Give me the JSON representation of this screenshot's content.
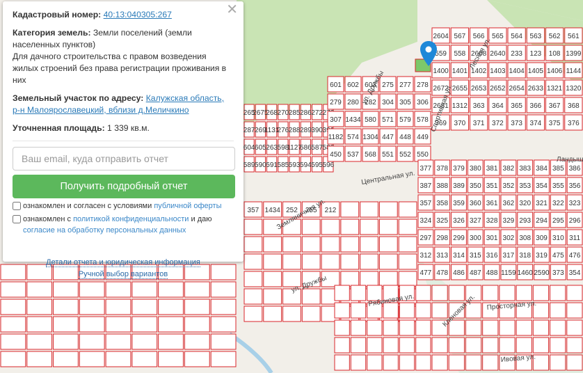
{
  "popup": {
    "cadastral_label": "Кадастровый номер:",
    "cadastral_number": "40:13:040305:267",
    "category_label": "Категория земель:",
    "category_value": "Земли поселений (земли населенных пунктов)",
    "usage": "Для дачного строительства с правом возведения жилых строений без права регистрации проживания в них",
    "address_label": "Земельный участок по адресу:",
    "address_value": "Калужская область, р-н Малоярославецкий, вблизи д.Меличкино",
    "area_label": "Уточненная площадь:",
    "area_value": "1 339 кв.м.",
    "email_placeholder": "Ваш email, куда отправить отчет",
    "submit_label": "Получить подробный отчет",
    "check1_text": "ознакомлен и согласен с условиями ",
    "check1_link": "публичной оферты",
    "check2_text": "ознакомлен с ",
    "check2_link": "политикой конфиденциальности",
    "check2_mid": " и даю ",
    "check2_link2": "согласие на обработку персональных данных",
    "details_link": "Детали отчета и юридическая информация",
    "manual_link": "Ручной выбор вариантов",
    "close": "✕"
  },
  "map": {
    "colors": {
      "parcel": "#d9262a",
      "green": "#c9e4b4",
      "selected": "#7cc86a",
      "pin": "#1e88d8"
    },
    "streets": [
      "ул. Дружбы",
      "Спортивная ул.",
      "Лесная ул.",
      "Центральная ул.",
      "Земляничная ул.",
      "Рябиновая ул.",
      "Кленовая ул.",
      "Просторная ул.",
      "Ивовая ул.",
      "Ландыш",
      "ул. Дружбы"
    ],
    "parcels": [
      "265",
      "2675",
      "268",
      "270",
      "285",
      "286",
      "272",
      "273",
      "287",
      "269",
      "1131",
      "276",
      "288",
      "289",
      "390",
      "391",
      "604",
      "605",
      "263",
      "598",
      "1127",
      "586",
      "587",
      "588",
      "589",
      "590",
      "591",
      "585",
      "593",
      "594",
      "595",
      "596",
      "601",
      "602",
      "603",
      "275",
      "277",
      "278",
      "279",
      "280",
      "282",
      "304",
      "305",
      "306",
      "307",
      "1434",
      "580",
      "571",
      "579",
      "578",
      "1182",
      "574",
      "1304",
      "447",
      "448",
      "449",
      "450",
      "537",
      "568",
      "551",
      "552",
      "550",
      "2604",
      "567",
      "566",
      "565",
      "564",
      "563",
      "562",
      "561",
      "559",
      "558",
      "2608",
      "2640",
      "233",
      "123",
      "108",
      "1399",
      "1400",
      "1401",
      "1402",
      "1403",
      "1404",
      "1405",
      "1406",
      "1144",
      "2672",
      "2655",
      "2653",
      "2652",
      "2654",
      "2633",
      "1321",
      "1320",
      "2681",
      "1312",
      "363",
      "364",
      "365",
      "366",
      "367",
      "368",
      "369",
      "370",
      "371",
      "372",
      "373",
      "374",
      "375",
      "376",
      "377",
      "378",
      "379",
      "380",
      "381",
      "382",
      "383",
      "384",
      "385",
      "386",
      "387",
      "388",
      "389",
      "350",
      "351",
      "352",
      "353",
      "354",
      "355",
      "356",
      "357",
      "358",
      "359",
      "360",
      "361",
      "362",
      "320",
      "321",
      "322",
      "323",
      "324",
      "325",
      "326",
      "327",
      "328",
      "329",
      "293",
      "294",
      "295",
      "296",
      "297",
      "298",
      "299",
      "300",
      "301",
      "302",
      "308",
      "309",
      "310",
      "311",
      "312",
      "313",
      "314",
      "315",
      "316",
      "317",
      "318",
      "319",
      "475",
      "476",
      "477",
      "478",
      "486",
      "487",
      "488",
      "1159",
      "1460",
      "2590",
      "373",
      "354",
      "357",
      "1434",
      "252",
      "255",
      "212"
    ],
    "pin_parcel": "267"
  }
}
